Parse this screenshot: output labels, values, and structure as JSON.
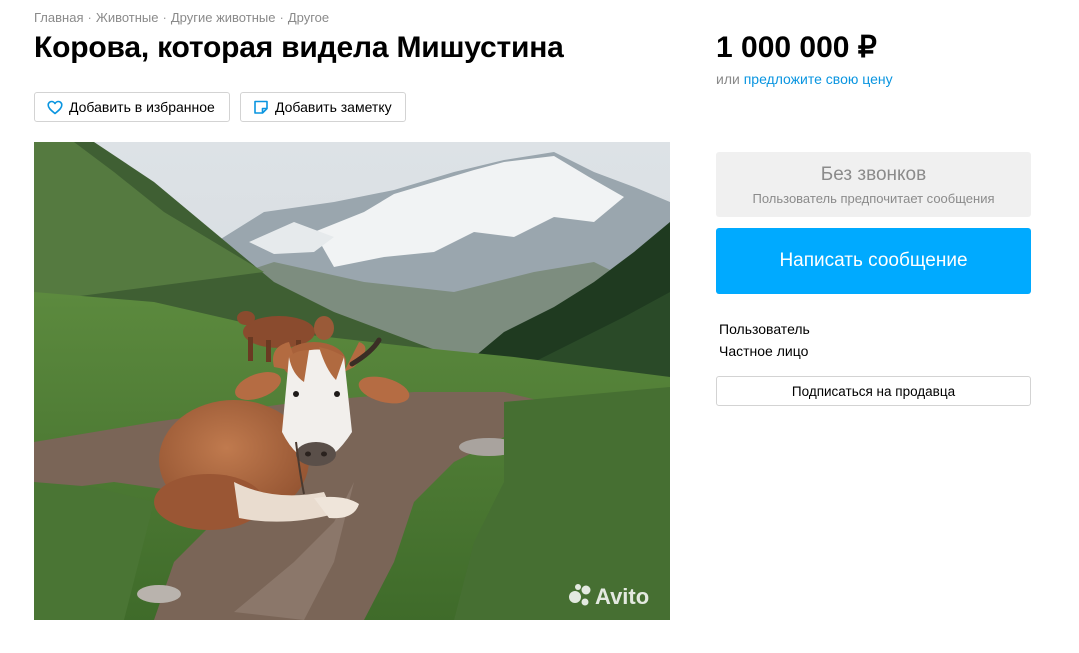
{
  "breadcrumb": {
    "items": [
      "Главная",
      "Животные",
      "Другие животные",
      "Другое"
    ],
    "separator": "·"
  },
  "listing": {
    "title": "Корова, которая видела Мишустина",
    "favorite_label": "Добавить в избранное",
    "note_label": "Добавить заметку",
    "photo_watermark": "Avito"
  },
  "price": {
    "value": "1 000 000 ₽",
    "alt_prefix": "или",
    "alt_link": "предложите свою цену"
  },
  "contact": {
    "no_calls_title": "Без звонков",
    "no_calls_sub": "Пользователь предпочитает сообщения",
    "message_button": "Написать сообщение"
  },
  "seller": {
    "name": "Пользователь",
    "type": "Частное лицо",
    "subscribe_button": "Подписаться на продавца"
  },
  "icons": {
    "favorite": "heart-icon",
    "note": "note-icon"
  },
  "colors": {
    "accent": "#00aaff",
    "link": "#0a95e0",
    "muted": "#8a8a8a",
    "panel": "#f0f0f0"
  }
}
